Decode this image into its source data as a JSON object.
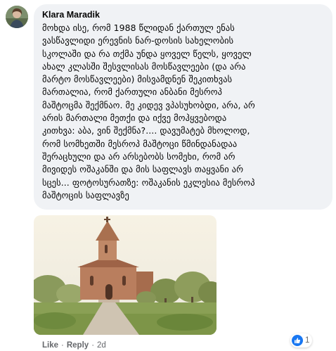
{
  "comment": {
    "author": "Klara Maradik",
    "text_lines": [
      "მოხდა ისე, რომ 1988 წლიდან ქართულ ენას",
      "ვასწავლიდი ერევნის ნარ-დოსის სახელობის",
      "სკოლაში და რა თქმა უნდა ყოველ წელს, ყოველ",
      "ახალ კლასში შესვლისას მოსწავლეები (და არა",
      "მარტო მოსწავლეები) მისვამდნენ შეკითხვას",
      "მართალია, რომ ქართული ანბანი მესროპ",
      "მაშტოცმა შექმნაო. მე კიდევ ვპასუხობდი, არა, არ",
      "არის მართალი მეთქი და იქვე მოჰყვებოდა",
      "კითხვა: აბა, ვინ შექმნა?.... დავუმატებ მხოლოდ,",
      "რომ სომხეთში მესროპ მაშტოცი წმინდანადაა",
      "შერაცხული და არ არსებობს სომეხი, რომ არ",
      "მივიდეს ოშაკანში და მის საფლავს თაყვანი არ",
      "სცეს... ფოტოსურათზე: ოშაკანის ეკლესია მესროპ",
      "მაშტოცის საფლავზე"
    ]
  },
  "actions": {
    "like": "Like",
    "separator": "·",
    "reply": "Reply",
    "time": "2d"
  },
  "reactions": {
    "count": "1",
    "icon": "like-thumb-icon",
    "color": "#1877f2"
  }
}
